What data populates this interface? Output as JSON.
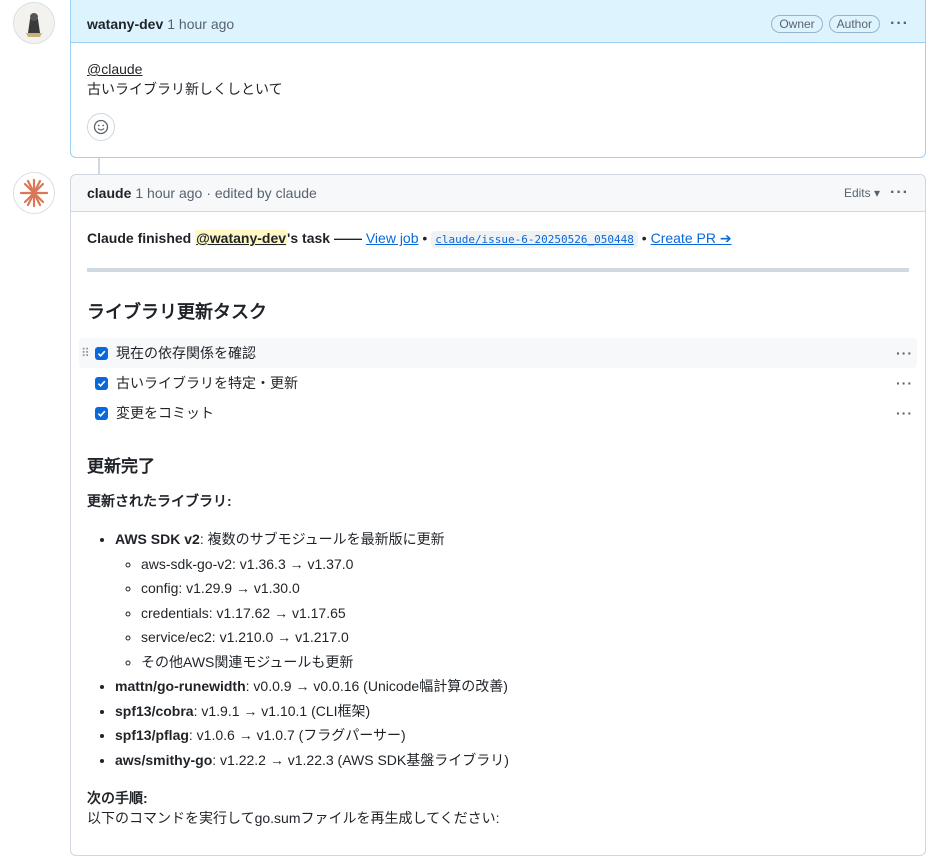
{
  "comment1": {
    "author": "watany-dev",
    "time": "1 hour ago",
    "badges": [
      "Owner",
      "Author"
    ],
    "mention": "@claude",
    "text": "古いライブラリ新しくしといて"
  },
  "comment2": {
    "author": "claude",
    "time": "1 hour ago",
    "edited": "· edited by claude",
    "edits_label": "Edits",
    "status": {
      "prefix": "Claude finished ",
      "mention": "@watany-dev",
      "suffix": "'s task —— ",
      "view_job": "View job",
      "sep": " • ",
      "branch": "claude/issue-6-20250526_050448",
      "create_pr": "Create PR ➔"
    },
    "heading": "ライブラリ更新タスク",
    "tasks": [
      {
        "label": "現在の依存関係を確認",
        "checked": true
      },
      {
        "label": "古いライブラリを特定・更新",
        "checked": true
      },
      {
        "label": "変更をコミット",
        "checked": true
      }
    ],
    "done_heading": "更新完了",
    "updated_label": "更新されたライブラリ:",
    "libs": [
      {
        "name": "AWS SDK v2",
        "desc": ": 複数のサブモジュールを最新版に更新"
      },
      {
        "name": "mattn/go-runewidth",
        "desc": ": v0.0.9 → v0.0.16 (Unicode幅計算の改善)"
      },
      {
        "name": "spf13/cobra",
        "desc": ": v1.9.1 → v1.10.1 (CLI框架)"
      },
      {
        "name": "spf13/pflag",
        "desc": ": v1.0.6 → v1.0.7 (フラグパーサー)"
      },
      {
        "name": "aws/smithy-go",
        "desc": ": v1.22.2 → v1.22.3 (AWS SDK基盤ライブラリ)"
      }
    ],
    "aws_sub": [
      "aws-sdk-go-v2: v1.36.3 → v1.37.0",
      "config: v1.29.9 → v1.30.0",
      "credentials: v1.17.62 → v1.17.65",
      "service/ec2: v1.210.0 → v1.217.0",
      "その他AWS関連モジュールも更新"
    ],
    "next_label": "次の手順:",
    "next_text": "以下のコマンドを実行してgo.sumファイルを再生成してください:"
  },
  "colors": {
    "accent": "#0969da",
    "owner_bg": "#ddf4ff",
    "claude_orange": "#d97757"
  }
}
